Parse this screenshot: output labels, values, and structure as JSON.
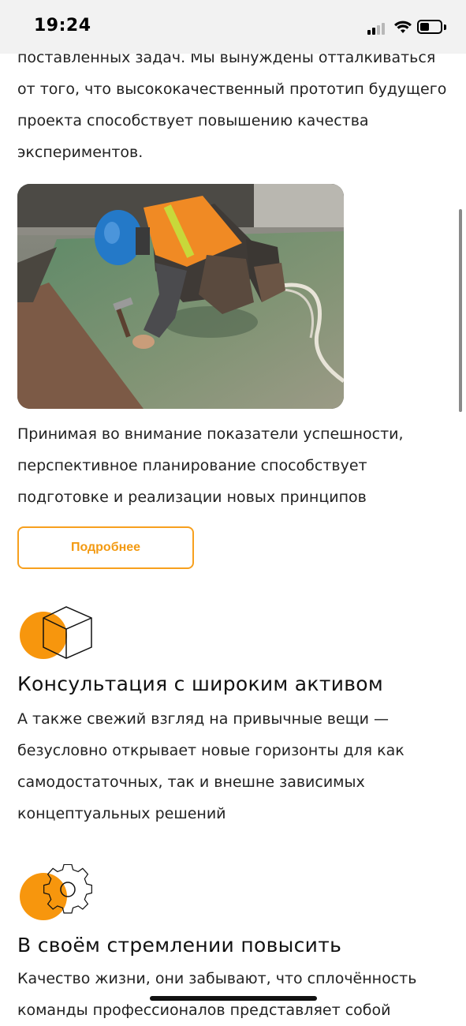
{
  "status_bar": {
    "time": "19:24",
    "battery_level": 0.35
  },
  "intro_text": "поставленных задач. Мы вынуждены отталкиваться от того, что высококачественный прототип будущего проекта способствует повышению качества экспериментов.",
  "hero_image": {
    "alt": "construction-worker-photo"
  },
  "body_text": "Принимая во внимание показатели успешности, перспективное планирование способствует подготовке и реализации новых принципов",
  "more_button": {
    "label": "Подробнее"
  },
  "features": [
    {
      "icon": "cube-icon",
      "title": "Консультация с широким активом",
      "text": "А также свежий взгляд на привычные вещи — безусловно открывает новые горизонты для как самодостаточных, так и внешне зависимых концептуальных решений"
    },
    {
      "icon": "gear-icon",
      "title": "В своём стремлении повысить",
      "text": "Качество жизни, они забывают, что сплочённость команды профессионалов представляет собой"
    }
  ],
  "colors": {
    "accent": "#f7960d",
    "button_border": "#f7a01e",
    "text": "#222222"
  }
}
